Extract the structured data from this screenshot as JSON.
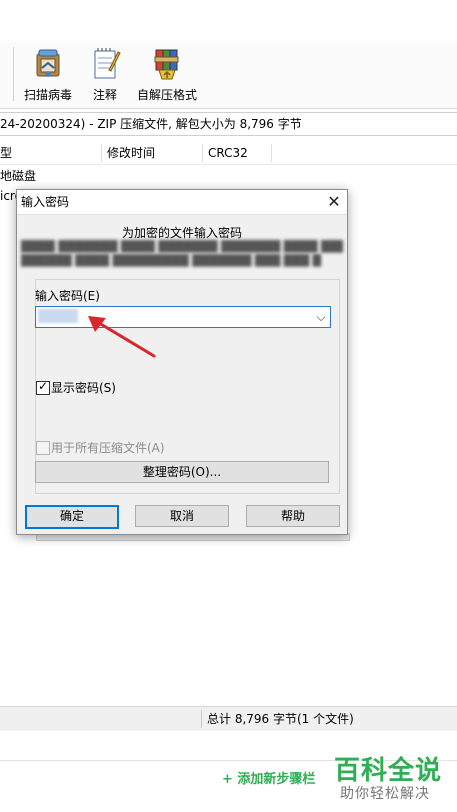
{
  "toolbar": {
    "buttons": [
      {
        "label": "扫描病毒",
        "icon": "virus-scan-icon"
      },
      {
        "label": "注释",
        "icon": "comment-notepad-icon"
      },
      {
        "label": "自解压格式",
        "icon": "sfx-archive-icon"
      }
    ]
  },
  "path_bar": {
    "text": "24-20200324) - ZIP 压缩文件, 解包大小为 8,796 字节"
  },
  "file_list": {
    "columns": [
      "型",
      "修改时间",
      "CRC32"
    ],
    "rows": [
      "地磁盘",
      "icro"
    ]
  },
  "status_bar": {
    "text": "总计 8,796 字节(1 个文件)"
  },
  "bottom": {
    "add_steps": "+ 添加新步骤栏"
  },
  "watermark": {
    "brand": "百科全说",
    "slogan": "助你轻松解决"
  },
  "dialog": {
    "title": "输入密码",
    "heading": "为加密的文件输入密码",
    "password_label": "输入密码(E)",
    "show_password_label": "显示密码(S)",
    "show_password_checked": true,
    "use_for_all_label": "用于所有压缩文件(A)",
    "use_for_all_checked": false,
    "organize_button": "整理密码(O)...",
    "ok_button": "确定",
    "cancel_button": "取消",
    "help_button": "帮助"
  },
  "colors": {
    "accent": "#0078d7",
    "annotation_arrow": "#d9262b",
    "brand_green": "#2fae54"
  }
}
